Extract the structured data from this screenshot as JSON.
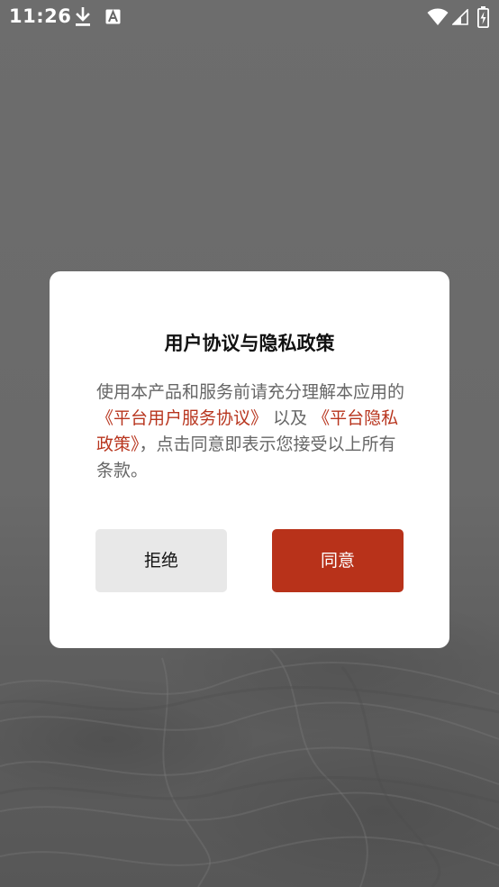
{
  "status_bar": {
    "time": "11:26",
    "icons": [
      "download-icon",
      "font-a-icon",
      "wifi-icon",
      "signal-icon",
      "battery-icon"
    ]
  },
  "dialog": {
    "title": "用户协议与隐私政策",
    "body_text_1": "使用本产品和服务前请充分理解本应用的 ",
    "user_agreement_link": "《平台用户服务协议》",
    "body_text_2": " 以及 ",
    "privacy_policy_link": "《平台隐私政策》",
    "body_text_3": "，点击同意即表示您接受以上所有条款。",
    "reject_label": "拒绝",
    "agree_label": "同意"
  },
  "colors": {
    "accent": "#b8321a",
    "link": "#b8351e",
    "overlay": "#6a6a6a"
  }
}
